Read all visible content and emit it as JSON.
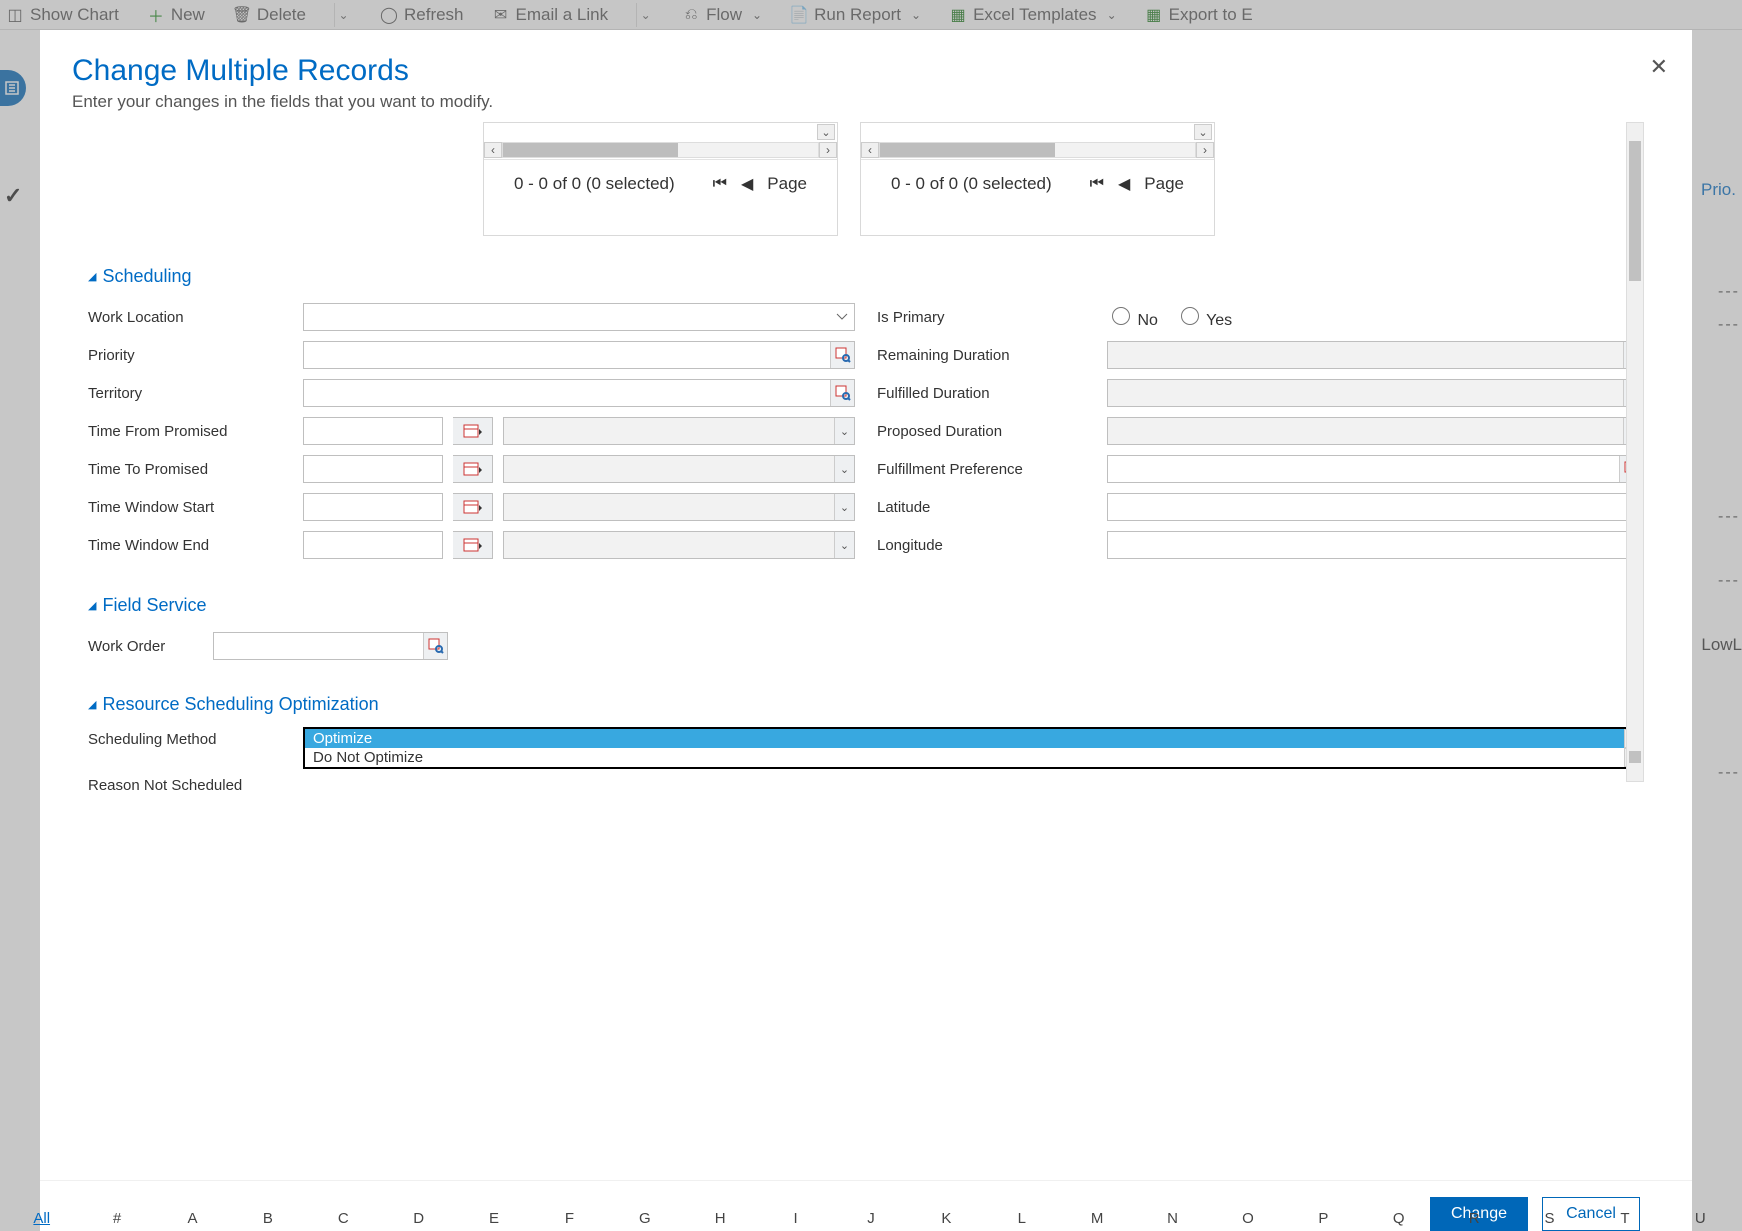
{
  "toolbar": {
    "show_chart": "Show Chart",
    "new": "New",
    "delete": "Delete",
    "refresh": "Refresh",
    "email_link": "Email a Link",
    "flow": "Flow",
    "run_report": "Run Report",
    "excel_templates": "Excel Templates",
    "export": "Export to E"
  },
  "bg": {
    "col_prio": "Prio.",
    "text_lowl": "LowL"
  },
  "alpha": {
    "all": "All",
    "hash": "#",
    "letters": [
      "A",
      "B",
      "C",
      "D",
      "E",
      "F",
      "G",
      "H",
      "I",
      "J",
      "K",
      "L",
      "M",
      "N",
      "O",
      "P",
      "Q",
      "R",
      "S",
      "T",
      "U"
    ]
  },
  "modal": {
    "title": "Change Multiple Records",
    "subtitle": "Enter your changes in the fields that you want to modify.",
    "close": "✕",
    "change": "Change",
    "cancel": "Cancel"
  },
  "grid": {
    "status1": "0 - 0 of 0 (0 selected)",
    "status2": "0 - 0 of 0 (0 selected)",
    "page": "Page"
  },
  "sections": {
    "scheduling": "Scheduling",
    "field_service": "Field Service",
    "rso": "Resource Scheduling Optimization"
  },
  "labels": {
    "work_location": "Work Location",
    "priority": "Priority",
    "territory": "Territory",
    "time_from_promised": "Time From Promised",
    "time_to_promised": "Time To Promised",
    "time_window_start": "Time Window Start",
    "time_window_end": "Time Window End",
    "is_primary": "Is Primary",
    "remaining_duration": "Remaining Duration",
    "fulfilled_duration": "Fulfilled Duration",
    "proposed_duration": "Proposed Duration",
    "fulfillment_preference": "Fulfillment Preference",
    "latitude": "Latitude",
    "longitude": "Longitude",
    "work_order": "Work Order",
    "scheduling_method": "Scheduling Method",
    "reason_not_scheduled": "Reason Not Scheduled",
    "no": "No",
    "yes": "Yes"
  },
  "dropdown": {
    "optimize": "Optimize",
    "do_not_optimize": "Do Not Optimize"
  }
}
